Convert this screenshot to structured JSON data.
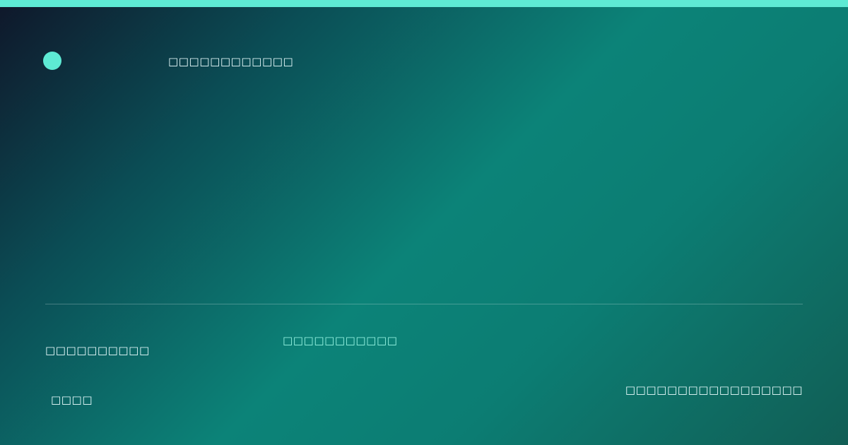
{
  "header": {
    "brand_text": "□□□□□□□□□□□□"
  },
  "footer": {
    "left_text": "□□□□□□□□□□",
    "middle_text": "□□□□□□□□□□□",
    "bottom_left_text": "□□□□",
    "bottom_right_text": "□□□□□□□□□□□□□□□□□"
  },
  "colors": {
    "accent": "#5eead4",
    "text_primary": "#ecfeff",
    "text_accent": "#99f6e4",
    "background_start": "#0f172a",
    "background_mid": "#0c8378",
    "background_end": "#115e55"
  }
}
